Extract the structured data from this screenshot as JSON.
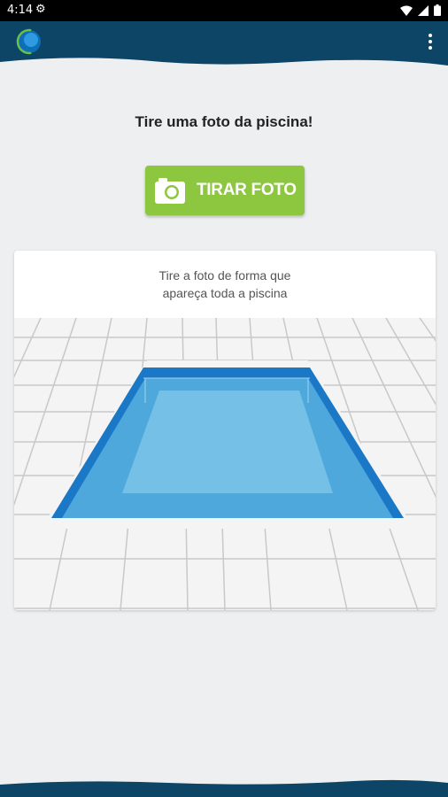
{
  "status_bar": {
    "time": "4:14",
    "icons": [
      "gear-icon",
      "wifi-icon",
      "signal-icon",
      "battery-icon"
    ]
  },
  "toolbar": {
    "logo": "app-logo",
    "menu_icon": "more-vert-icon",
    "background_color": "#0c4566"
  },
  "main": {
    "title": "Tire uma foto da piscina!",
    "take_photo_button": {
      "label": "TIRAR FOTO",
      "icon": "camera-icon",
      "color": "#8dc63f"
    },
    "instruction_card": {
      "line1": "Tire a foto de forma que",
      "line2": "apareça toda a piscina",
      "illustration": "pool-illustration"
    }
  }
}
